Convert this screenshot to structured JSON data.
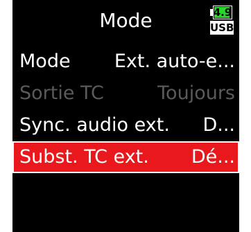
{
  "header": {
    "title": "Mode",
    "battery_value": "4.9",
    "battery_level": 0.9,
    "power_source": "USB"
  },
  "menu": {
    "items": [
      {
        "label": "Mode",
        "value": "Ext. auto-e...",
        "state": "normal"
      },
      {
        "label": "Sortie TC",
        "value": "Toujours",
        "state": "disabled"
      },
      {
        "label": "Sync. audio ext.",
        "value": "D...",
        "state": "normal"
      },
      {
        "label": "Subst. TC ext.",
        "value": "Dé...",
        "state": "selected"
      }
    ]
  },
  "colors": {
    "screen_bg": "#000000",
    "text": "#ffffff",
    "disabled_text": "#5a5a5a",
    "selection": "#e8181c",
    "battery_fill": "#2bd62b"
  }
}
